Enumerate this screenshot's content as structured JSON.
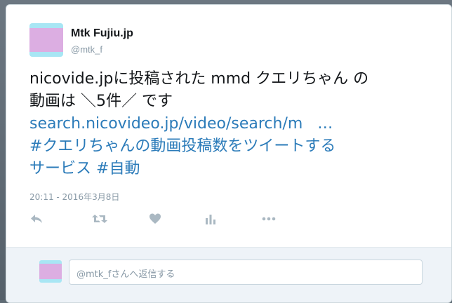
{
  "tweet": {
    "author_name": "Mtk Fujiu.jp",
    "author_handle": "@mtk_f",
    "text_line1": "nicovide.jpに投稿された mmd クエリちゃん の",
    "text_line2": "動画は ＼5件／ です",
    "link_text": "search.nicovideo.jp/video/search/m   …",
    "hashtag_line1": "#クエリちゃんの動画投稿数をツイートする",
    "hashtag_line2a": "サービス",
    "hashtag_line2b": "#自動",
    "timestamp": "20:11 - 2016年3月8日"
  },
  "actions": {
    "reply_icon": "reply-icon",
    "retweet_icon": "retweet-icon",
    "like_icon": "heart-icon",
    "analytics_icon": "analytics-icon",
    "more_icon": "more-icon"
  },
  "reply": {
    "placeholder": "@mtk_fさんへ返信する"
  },
  "colors": {
    "link": "#2b7bb9",
    "muted": "#8899a6",
    "icon": "#aab8c2",
    "avatar_band": "#a8e6f4",
    "avatar_center": "#dcaee2"
  }
}
